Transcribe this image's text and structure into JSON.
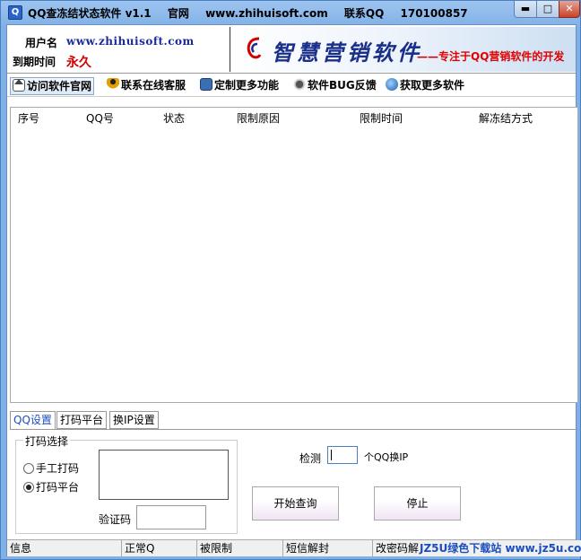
{
  "window": {
    "title": "QQ查冻结状态软件 v1.1",
    "title_site_label": "官网",
    "title_site": "www.zhihuisoft.com",
    "title_contact_label": "联系QQ",
    "title_contact": "170100857",
    "min_label": "▬",
    "max_label": "□",
    "close_label": "✕"
  },
  "header": {
    "user_label": "用户名",
    "user_value": "www.zhihuisoft.com",
    "expire_label": "到期时间",
    "expire_value": "永久",
    "banner_main": "智慧营销软件",
    "banner_sub": "——专注于QQ营销软件的开发"
  },
  "toolbar": {
    "items": [
      {
        "label": "访问软件官网",
        "icon": "home-icon"
      },
      {
        "label": "联系在线客服",
        "icon": "person-icon"
      },
      {
        "label": "定制更多功能",
        "icon": "monitor-icon"
      },
      {
        "label": "软件BUG反馈",
        "icon": "bug-icon"
      },
      {
        "label": "获取更多软件",
        "icon": "globe-icon"
      }
    ]
  },
  "table": {
    "columns": [
      "序号",
      "QQ号",
      "状态",
      "限制原因",
      "限制时间",
      "解冻结方式"
    ],
    "rows": []
  },
  "tabs": [
    "QQ设置",
    "打码平台",
    "换IP设置"
  ],
  "settings": {
    "group_title": "打码选择",
    "radio_manual": "手工打码",
    "radio_platform": "打码平台",
    "selected": "打码平台",
    "verify_label": "验证码",
    "detect_label": "检测",
    "detect_value": "",
    "detect_suffix": "个QQ换IP",
    "start_button": "开始查询",
    "stop_button": "停止"
  },
  "statusbar": [
    "信息",
    "正常Q",
    "被限制",
    "短信解封",
    "改密码解"
  ],
  "watermark": "JZ5U绿色下载站 www.jz5u.com",
  "colors": {
    "title_bar": "#7fb0e6",
    "expire_value": "#d40000",
    "banner_text": "#1a2f8a",
    "banner_sub": "#e00000",
    "active_tab": "#1a4ec0"
  }
}
